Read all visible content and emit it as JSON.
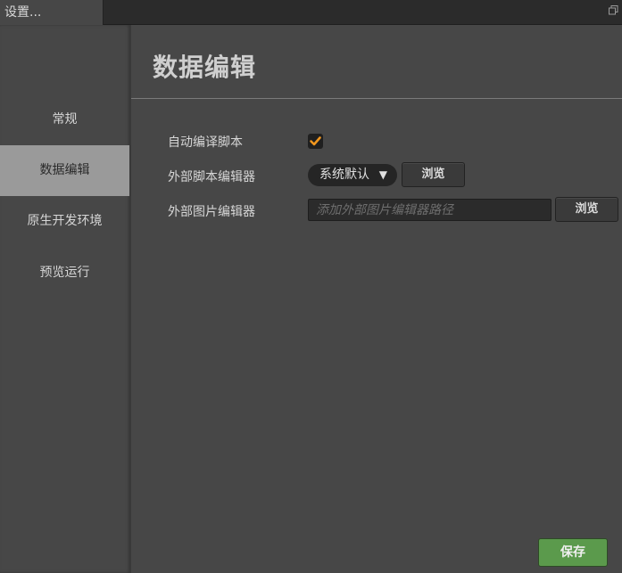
{
  "window": {
    "tab_title": "设置...",
    "maximize_icon": "restore-window-icon"
  },
  "sidebar": {
    "items": [
      {
        "label": "常规",
        "active": false
      },
      {
        "label": "数据编辑",
        "active": true
      },
      {
        "label": "原生开发环境",
        "active": false
      },
      {
        "label": "预览运行",
        "active": false
      }
    ]
  },
  "main": {
    "title": "数据编辑",
    "auto_compile": {
      "label": "自动编译脚本",
      "checked": true,
      "check_color": "#f0961e"
    },
    "script_editor": {
      "label": "外部脚本编辑器",
      "selected": "系统默认",
      "arrow": "▼",
      "browse_label": "浏览"
    },
    "image_editor": {
      "label": "外部图片编辑器",
      "value": "",
      "placeholder": "添加外部图片编辑器路径",
      "browse_label": "浏览"
    },
    "save_label": "保存"
  },
  "colors": {
    "background": "#474747",
    "active_nav": "#9a9a9a",
    "save_button": "#5b9a4c",
    "accent_check": "#f0961e"
  }
}
